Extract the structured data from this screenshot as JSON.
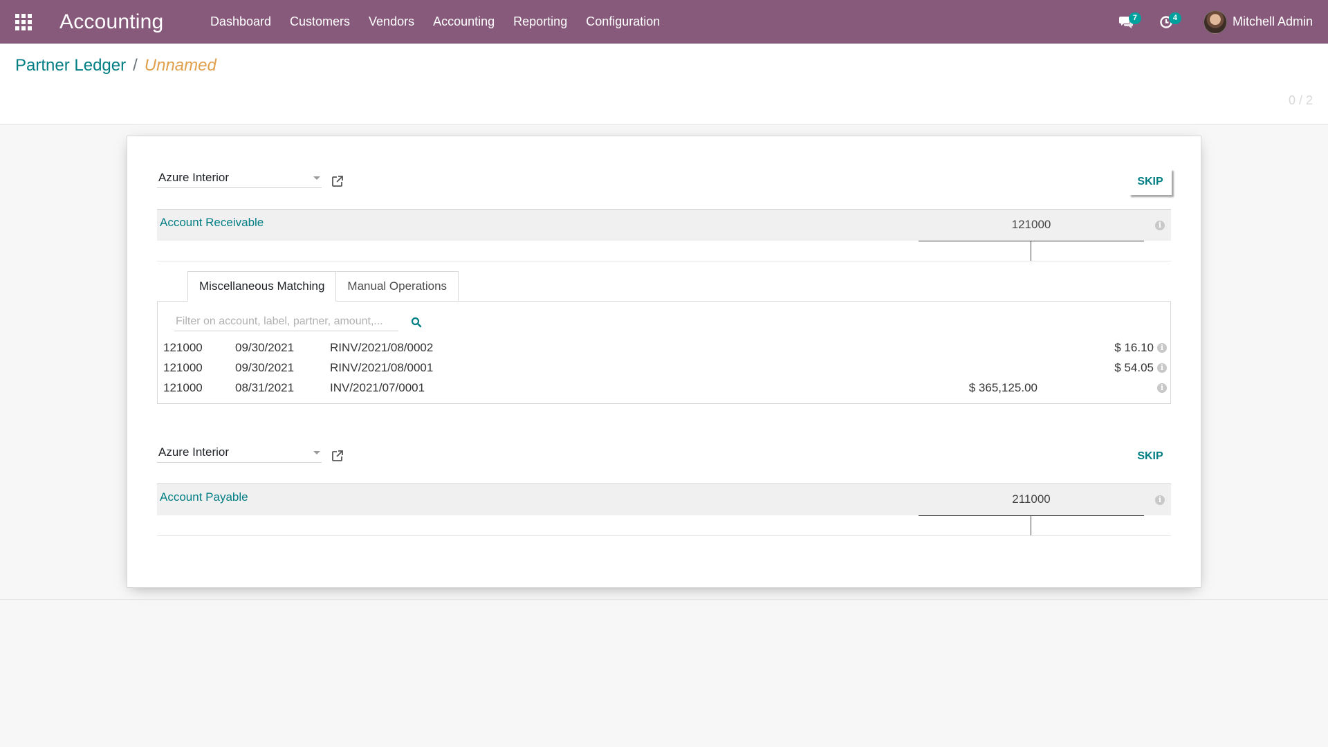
{
  "navbar": {
    "app_title": "Accounting",
    "menu": [
      "Dashboard",
      "Customers",
      "Vendors",
      "Accounting",
      "Reporting",
      "Configuration"
    ],
    "messages_count": "7",
    "activities_count": "4",
    "user_name": "Mitchell Admin"
  },
  "breadcrumb": {
    "parent": "Partner Ledger",
    "separator": "/",
    "current": "Unnamed"
  },
  "pager": "0 / 2",
  "reconciliations": [
    {
      "partner": "Azure Interior",
      "skip_label": "SKIP",
      "account_name": "Account Receivable",
      "account_code": "121000",
      "tabs": [
        "Miscellaneous Matching",
        "Manual Operations"
      ],
      "filter_placeholder": "Filter on account, label, partner, amount,...",
      "lines": [
        {
          "account": "121000",
          "date": "09/30/2021",
          "ref": "RINV/2021/08/0002",
          "debit": "",
          "credit": "$ 16.10"
        },
        {
          "account": "121000",
          "date": "09/30/2021",
          "ref": "RINV/2021/08/0001",
          "debit": "",
          "credit": "$ 54.05"
        },
        {
          "account": "121000",
          "date": "08/31/2021",
          "ref": "INV/2021/07/0001",
          "debit": "$ 365,125.00",
          "credit": ""
        }
      ]
    },
    {
      "partner": "Azure Interior",
      "skip_label": "SKIP",
      "account_name": "Account Payable",
      "account_code": "211000"
    }
  ],
  "colors": {
    "navbar": "#875a7b",
    "link": "#017e84",
    "current_breadcrumb": "#e0a04d",
    "badge": "#00a09d"
  }
}
